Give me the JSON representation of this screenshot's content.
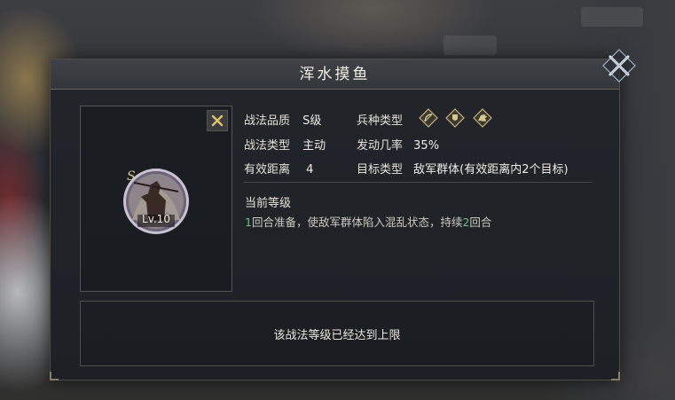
{
  "dialog": {
    "title": "浑水摸鱼",
    "grade_letter": "S",
    "level_label": "Lv.10"
  },
  "attributes": {
    "quality_label": "战法品质",
    "quality_value": "S级",
    "troop_label": "兵种类型",
    "troop_icons": [
      "bow-troop-icon",
      "shield-troop-icon",
      "cavalry-troop-icon"
    ],
    "skill_type_label": "战法类型",
    "skill_type_value": "主动",
    "trigger_label": "发动几率",
    "trigger_value": "35%",
    "range_label": "有效距离",
    "range_value": "4",
    "target_label": "目标类型",
    "target_value": "敌军群体(有效距离内2个目标)"
  },
  "current_level": {
    "heading": "当前等级",
    "desc_num1": "1",
    "desc_part1": "回合准备，使敌军群体陷入混乱状态，持续",
    "desc_num2": "2",
    "desc_part2": "回合"
  },
  "footer": {
    "message": "该战法等级已经达到上限"
  },
  "colors": {
    "highlight": "#6fc08c",
    "gold": "#d6c38a"
  }
}
